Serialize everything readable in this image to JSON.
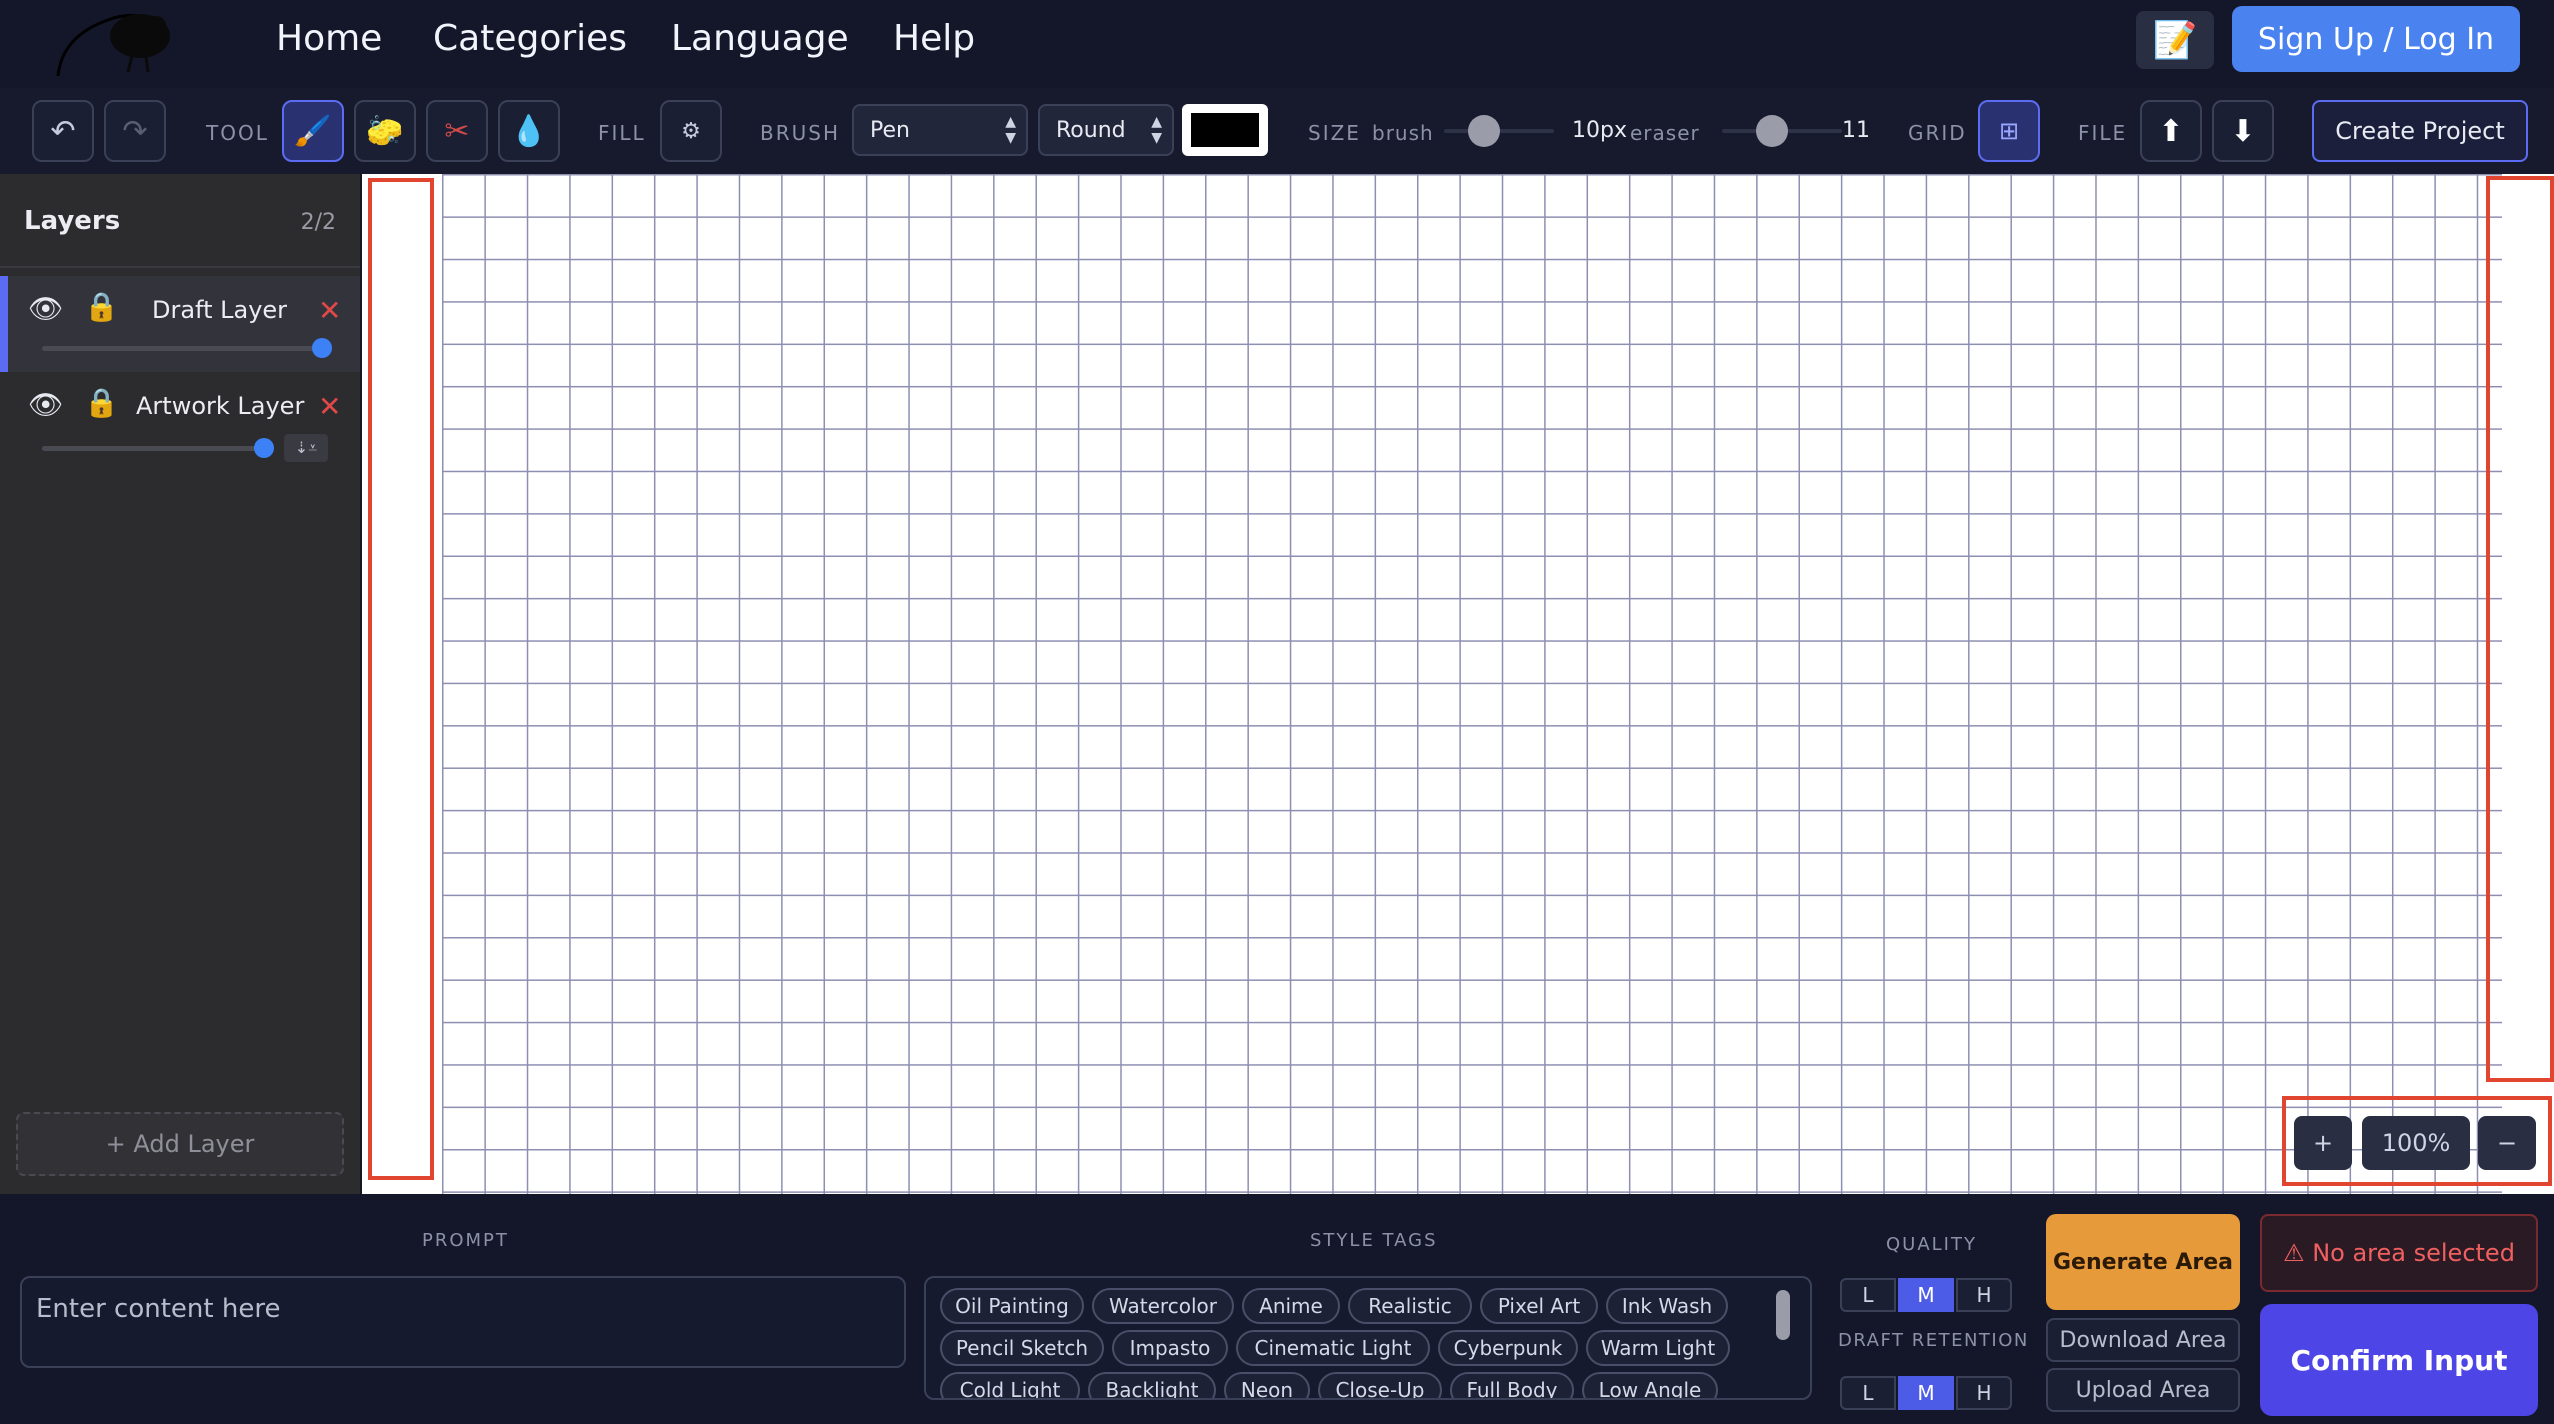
{
  "nav": {
    "links": [
      "Home",
      "Categories",
      "Language",
      "Help"
    ],
    "notes_icon": "memo-icon",
    "signup": "Sign Up / Log In"
  },
  "toolbar": {
    "tool_label": "TOOL",
    "fill_label": "FILL",
    "brush_label": "BRUSH",
    "brush_type": "Pen",
    "brush_shape": "Round",
    "brush_color": "#000000",
    "size_label": "SIZE",
    "brush_small": "brush",
    "brush_size": "10px",
    "eraser_small": "eraser",
    "eraser_size": "11",
    "grid_label": "GRID",
    "file_label": "FILE",
    "create_project": "Create Project"
  },
  "layers": {
    "title": "Layers",
    "count": "2/2",
    "items": [
      {
        "name": "Draft Layer",
        "opacity": 1.0
      },
      {
        "name": "Artwork Layer",
        "opacity": 1.0
      }
    ],
    "add_layer": "+ Add Layer"
  },
  "canvas": {
    "zoom_in": "+",
    "zoom_level": "100%",
    "zoom_out": "−"
  },
  "bottom": {
    "prompt_label": "PROMPT",
    "prompt_placeholder": "Enter content here",
    "style_tags_label": "STYLE TAGS",
    "tags_row1": [
      "Oil Painting",
      "Watercolor",
      "Anime",
      "Realistic",
      "Pixel Art",
      "Ink Wash"
    ],
    "tags_row2": [
      "Pencil Sketch",
      "Impasto",
      "Cinematic Light",
      "Cyberpunk",
      "Warm Light"
    ],
    "tags_row3": [
      "Cold Light",
      "Backlight",
      "Neon",
      "Close-Up",
      "Full Body",
      "Low Angle"
    ],
    "quality_label": "QUALITY",
    "quality_options": [
      "L",
      "M",
      "H"
    ],
    "quality_selected": "M",
    "retention_label": "DRAFT RETENTION",
    "retention_options": [
      "L",
      "M",
      "H"
    ],
    "retention_selected": "M",
    "generate": "Generate Area",
    "download": "Download Area",
    "upload": "Upload Area",
    "no_area": "⚠ No area selected",
    "confirm": "Confirm Input"
  }
}
